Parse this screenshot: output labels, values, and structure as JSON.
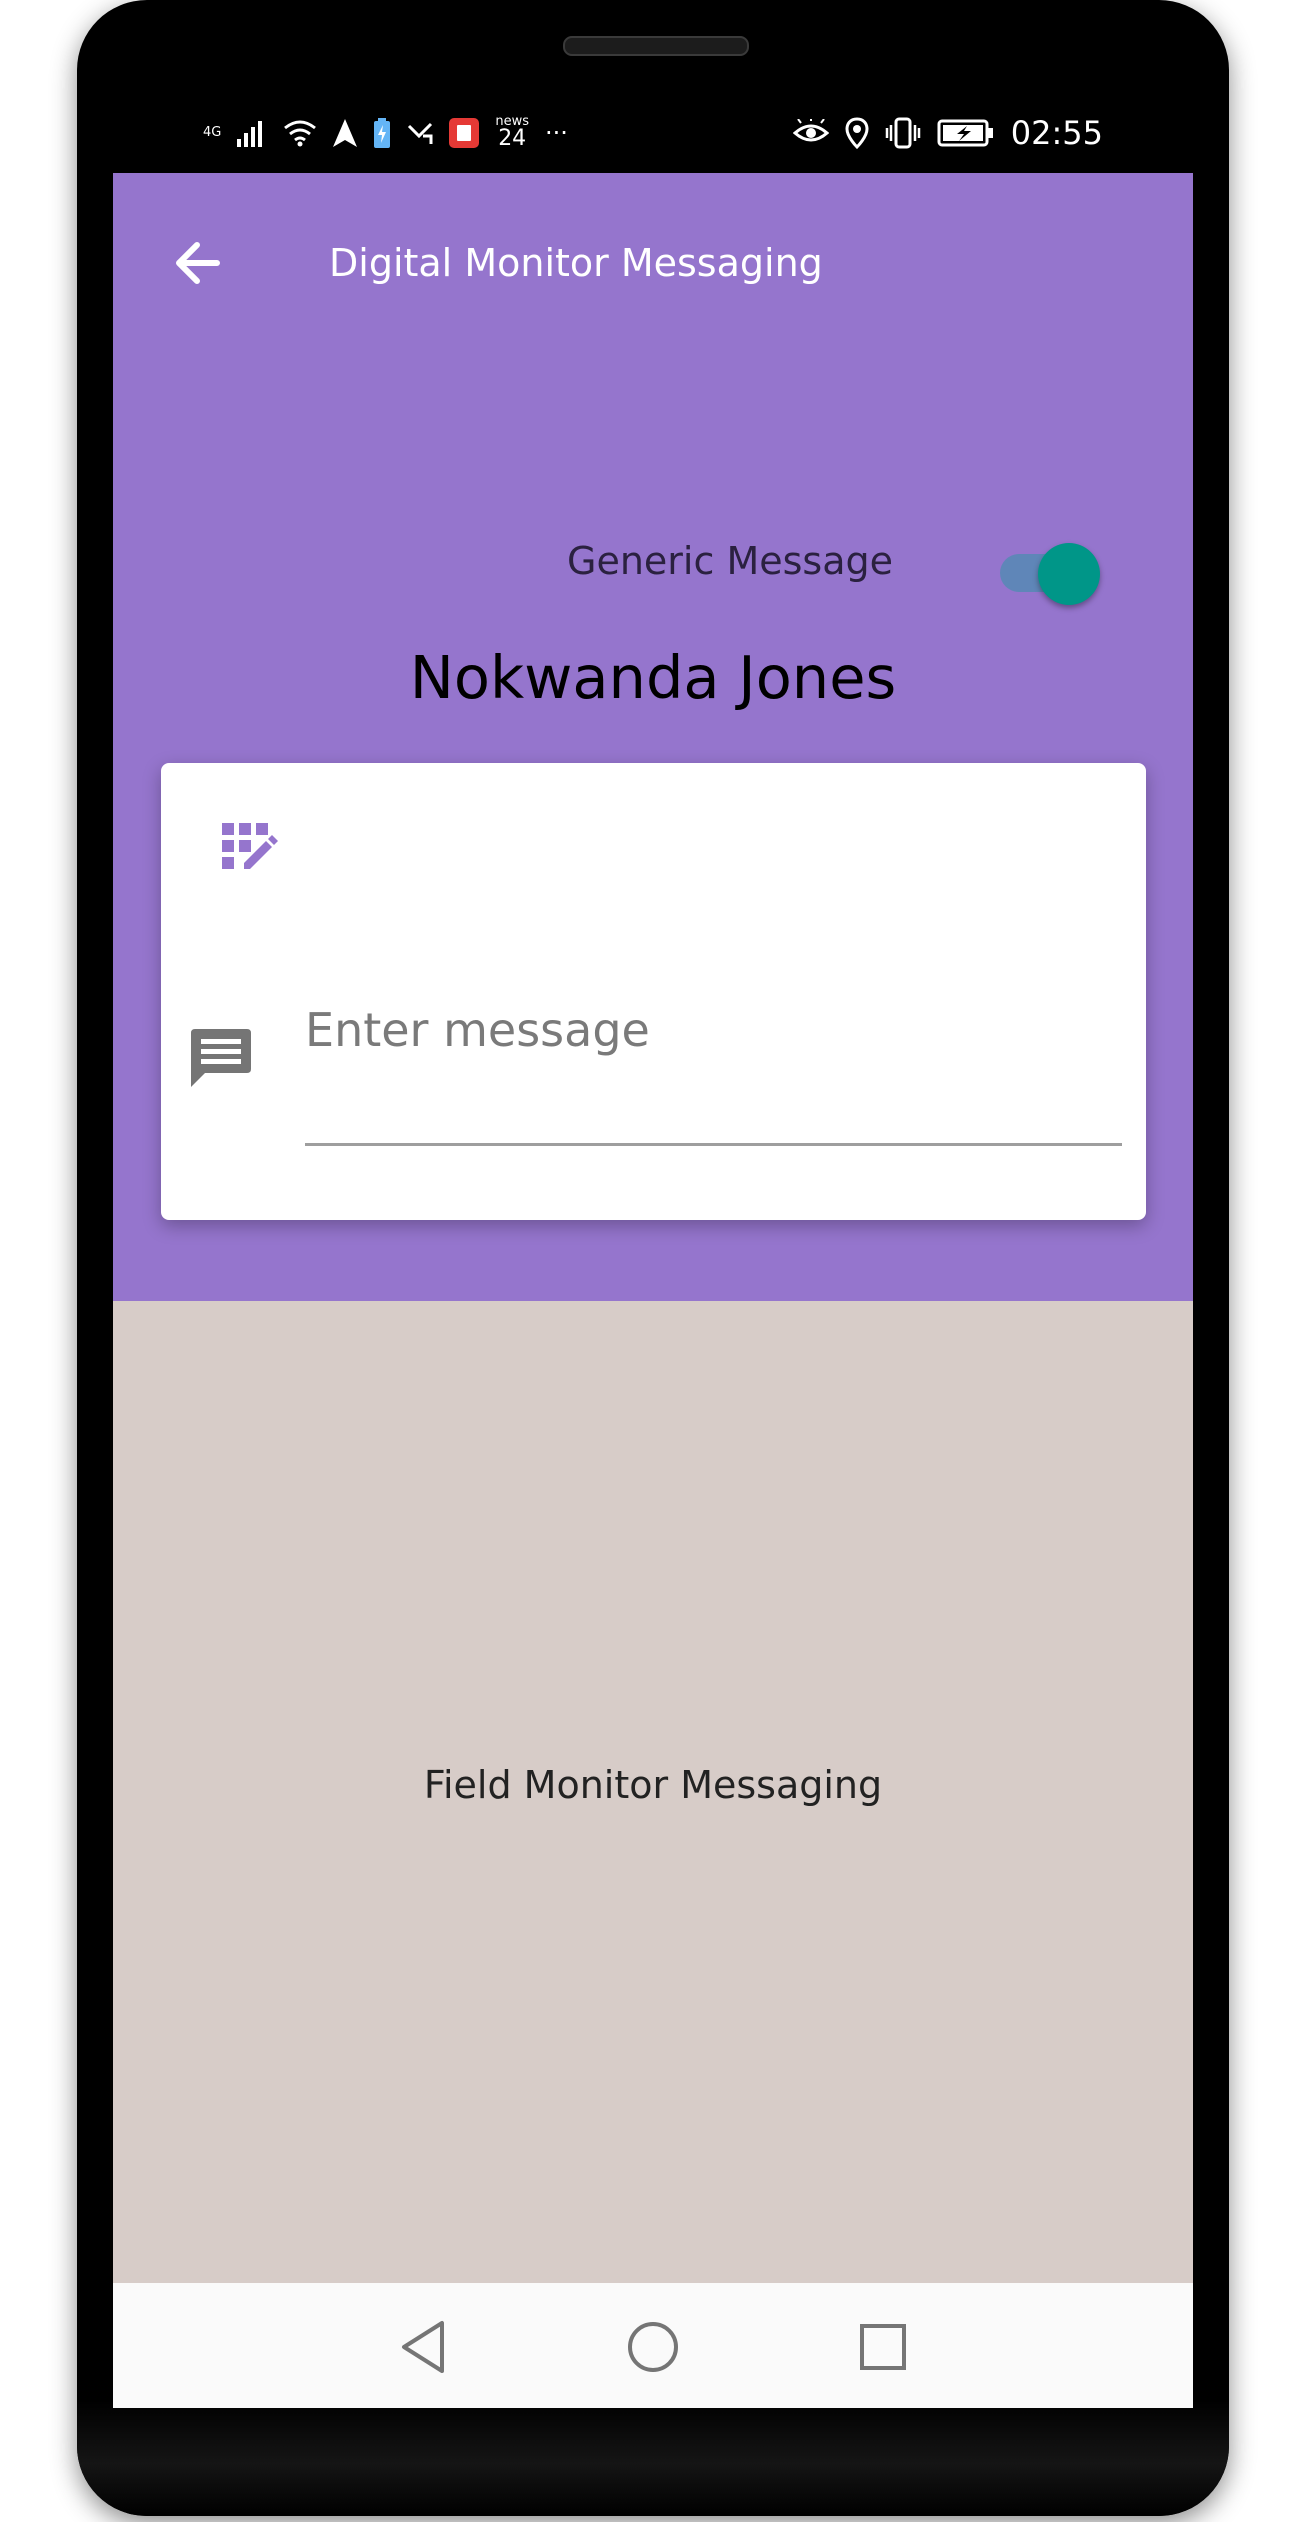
{
  "status_bar": {
    "network": "4G",
    "news_label": "news",
    "news_count": "24",
    "more": "···",
    "time": "02:55"
  },
  "app_bar": {
    "title": "Digital Monitor Messaging",
    "back_icon": "arrow-left-icon"
  },
  "message_type": {
    "label": "Generic Message",
    "toggle_on": true,
    "track_color": "#5f86b8",
    "thumb_color": "#009688"
  },
  "recipient": {
    "name": "Nokwanda Jones"
  },
  "compose": {
    "template_icon": "grid-edit-icon",
    "message_icon": "message-icon",
    "placeholder": "Enter message",
    "value": ""
  },
  "field_section": {
    "label": "Field Monitor Messaging"
  },
  "nav_bar": {
    "back": "triangle-back-icon",
    "home": "circle-home-icon",
    "recents": "square-recents-icon"
  },
  "colors": {
    "header_purple": "#9575cd",
    "lower_background": "#d7ccc8",
    "accent_teal": "#009688"
  }
}
